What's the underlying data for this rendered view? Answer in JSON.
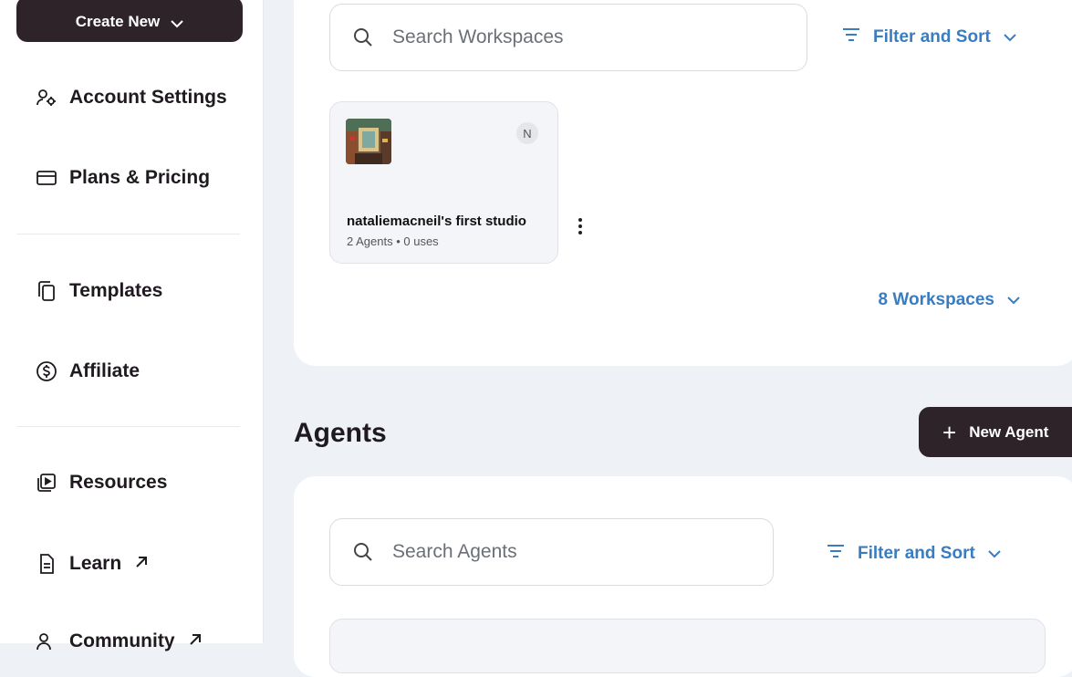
{
  "sidebar": {
    "create_new_label": "Create New",
    "items": [
      {
        "label": "Account Settings",
        "icon": "account-settings-icon"
      },
      {
        "label": "Plans & Pricing",
        "icon": "credit-card-icon"
      },
      {
        "label": "Templates",
        "icon": "copy-icon"
      },
      {
        "label": "Affiliate",
        "icon": "dollar-icon"
      },
      {
        "label": "Resources",
        "icon": "play-book-icon"
      },
      {
        "label": "Learn",
        "icon": "document-icon",
        "external": true
      },
      {
        "label": "Community",
        "icon": "people-icon",
        "external": true
      }
    ]
  },
  "workspaces": {
    "search_placeholder": "Search Workspaces",
    "filter_label": "Filter and Sort",
    "items": [
      {
        "name": "nataliemacneil's first studio",
        "meta": "2 Agents • 0 uses",
        "owner_initial": "N"
      }
    ],
    "count_label": "8 Workspaces"
  },
  "agents": {
    "title": "Agents",
    "new_label": "New Agent",
    "search_placeholder": "Search Agents",
    "filter_label": "Filter and Sort"
  },
  "colors": {
    "accent": "#3a7cc0",
    "dark_button": "#2e2329",
    "background": "#eef1f5"
  }
}
